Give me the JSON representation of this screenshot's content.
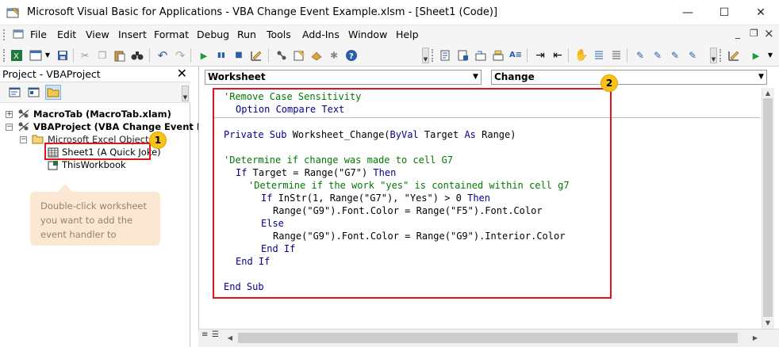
{
  "window": {
    "title": "Microsoft Visual Basic for Applications - VBA Change Event Example.xlsm - [Sheet1 (Code)]",
    "minimize": "—",
    "maximize": "☐",
    "close": "✕"
  },
  "menu": {
    "items": [
      "File",
      "Edit",
      "View",
      "Insert",
      "Format",
      "Debug",
      "Run",
      "Tools",
      "Add-Ins",
      "Window",
      "Help"
    ],
    "mdi_minimize": "_",
    "mdi_restore": "❐",
    "mdi_close": "×"
  },
  "project_pane": {
    "title": "Project - VBAProject",
    "close": "✕",
    "tree": {
      "macrotab": "MacroTab (MacroTab.xlam)",
      "vbaproject": "VBAProject (VBA Change Event Exa",
      "excel_objects": "Microsoft Excel Objects",
      "sheet1": "Sheet1 (A Quick Joke)",
      "thisworkbook": "ThisWorkbook"
    },
    "callout": "Double-click  worksheet you want to add the event handler to",
    "badge1": "1"
  },
  "code_window": {
    "object_combo": "Worksheet",
    "procedure_combo": "Change",
    "badge2": "2",
    "code": {
      "l1": "'Remove Case Sensitivity",
      "l2_kw": "Option Compare Text",
      "l3_a": "Private Sub",
      "l3_b": " Worksheet_Change(",
      "l3_c": "ByVal",
      "l3_d": " Target ",
      "l3_e": "As",
      "l3_f": " Range)",
      "l4": "'Determine if change was made to cell G7",
      "l5_a": "If",
      "l5_b": " Target = Range(\"G7\") ",
      "l5_c": "Then",
      "l6": "'Determine if the work \"yes\" is contained within cell g7",
      "l7_a": "If",
      "l7_b": " InStr(1, Range(\"G7\"), \"Yes\") > 0 ",
      "l7_c": "Then",
      "l8": "Range(\"G9\").Font.Color = Range(\"F5\").Font.Color",
      "l9": "Else",
      "l10": "Range(\"G9\").Font.Color = Range(\"G9\").Interior.Color",
      "l11": "End If",
      "l12": "End If",
      "l13": "End Sub"
    }
  },
  "colors": {
    "highlight": "#e3131c",
    "badge": "#f9c21a",
    "callout": "#fce7d2",
    "keyword": "#00008b",
    "comment": "#007a00"
  }
}
